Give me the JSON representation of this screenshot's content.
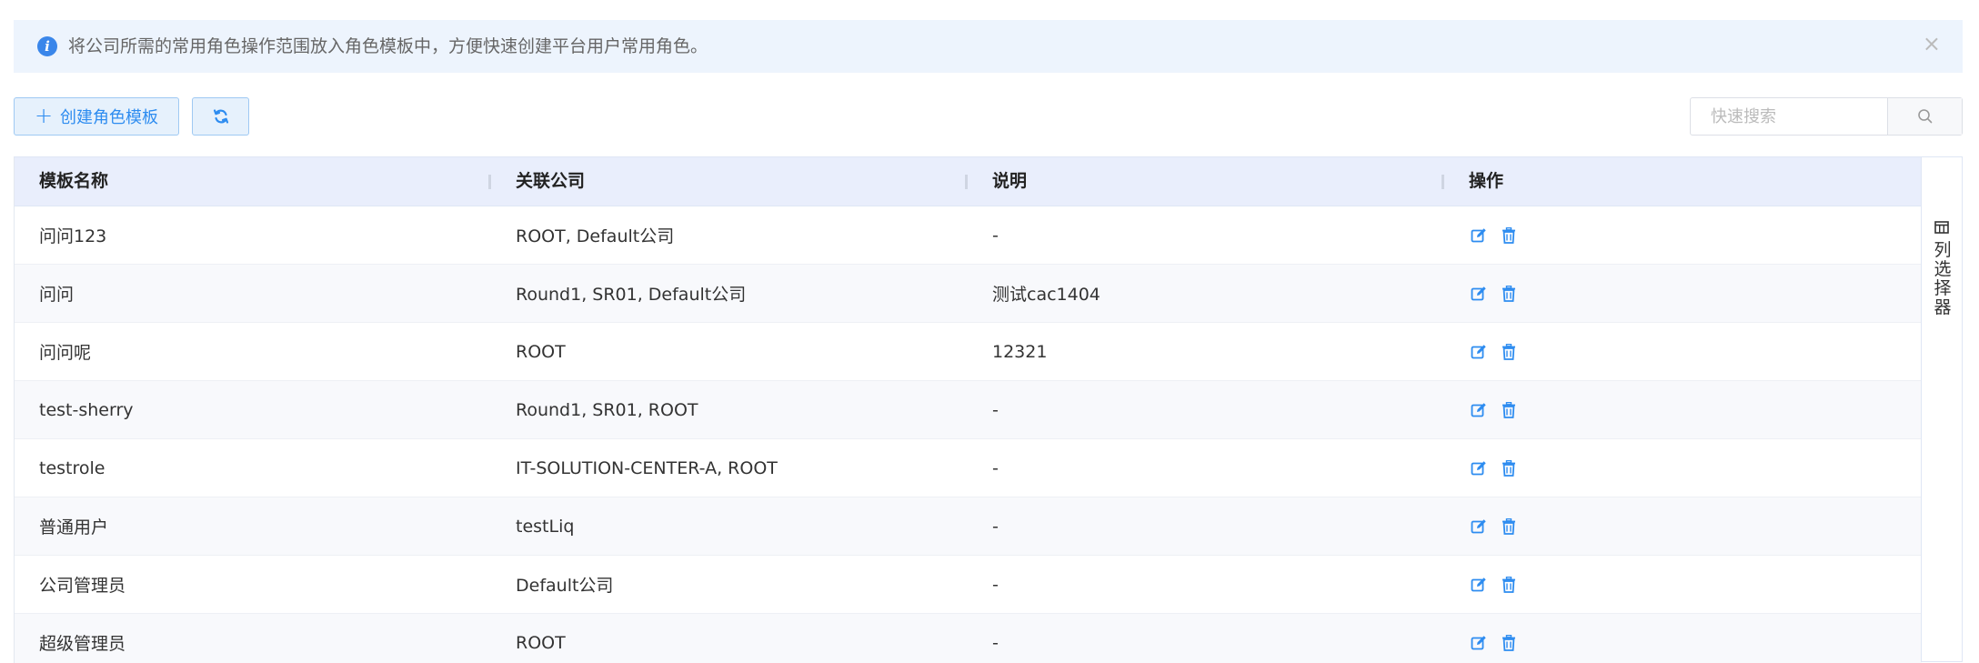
{
  "alert": {
    "message": "将公司所需的常用角色操作范围放入角色模板中，方便快速创建平台用户常用角色。",
    "close": "×"
  },
  "toolbar": {
    "create_icon": "+",
    "create_label": "创建角色模板",
    "refresh_icon": "refresh-icon",
    "search_placeholder": "快速搜索",
    "search_icon": "search-icon"
  },
  "table": {
    "columns": [
      "模板名称",
      "关联公司",
      "说明",
      "操作"
    ],
    "rows": [
      {
        "name": "问问123",
        "company": "ROOT, Default公司",
        "desc": "-"
      },
      {
        "name": "问问",
        "company": "Round1, SR01, Default公司",
        "desc": "测试cac1404"
      },
      {
        "name": "问问呢",
        "company": "ROOT",
        "desc": "12321"
      },
      {
        "name": "test-sherry",
        "company": "Round1, SR01, ROOT",
        "desc": "-"
      },
      {
        "name": "testrole",
        "company": "IT-SOLUTION-CENTER-A, ROOT",
        "desc": "-"
      },
      {
        "name": "普通用户",
        "company": "testLiq",
        "desc": "-"
      },
      {
        "name": "公司管理员",
        "company": "Default公司",
        "desc": "-"
      },
      {
        "name": "超级管理员",
        "company": "ROOT",
        "desc": "-"
      }
    ],
    "row_actions": [
      "edit-icon",
      "delete-icon"
    ]
  },
  "column_selector": {
    "icon": "columns-icon",
    "label": "列\n选\n择\n器"
  },
  "colors": {
    "accent": "#2d8cf0",
    "alert_bg": "#edf4fd",
    "header_bg": "#e9eefc"
  }
}
